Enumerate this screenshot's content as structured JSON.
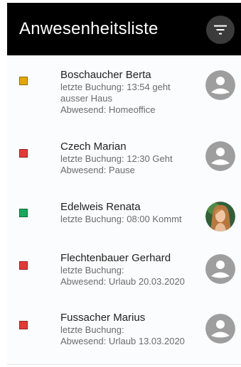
{
  "header": {
    "title": "Anwesenheitsliste",
    "filter_icon": "filter-list-icon"
  },
  "colors": {
    "header_bg": "#000000",
    "present": "#17a85a",
    "absent": "#e53935",
    "away": "#e2a800"
  },
  "employees": [
    {
      "name": "Boschaucher Berta",
      "lines": [
        "letzte Buchung: 13:54 geht",
        "ausser Haus",
        "Abwesend: Homeoffice"
      ],
      "status_color": "#e2a800",
      "avatar": "default-avatar-icon"
    },
    {
      "name": "Czech Marian",
      "lines": [
        "letzte Buchung: 12:30 Geht",
        "Abwesend: Pause"
      ],
      "status_color": "#e53935",
      "avatar": "default-avatar-icon"
    },
    {
      "name": "Edelweis Renata",
      "lines": [
        "letzte Buchung: 08:00 Kommt"
      ],
      "status_color": "#17a85a",
      "avatar": "photo-avatar"
    },
    {
      "name": "Flechtenbauer Gerhard",
      "lines": [
        "letzte Buchung:",
        "Abwesend: Urlaub 20.03.2020"
      ],
      "status_color": "#e53935",
      "avatar": "default-avatar-icon"
    },
    {
      "name": "Fussacher Marius",
      "lines": [
        "letzte Buchung:",
        "Abwesend: Urlaub 13.03.2020"
      ],
      "status_color": "#e53935",
      "avatar": "default-avatar-icon"
    }
  ]
}
